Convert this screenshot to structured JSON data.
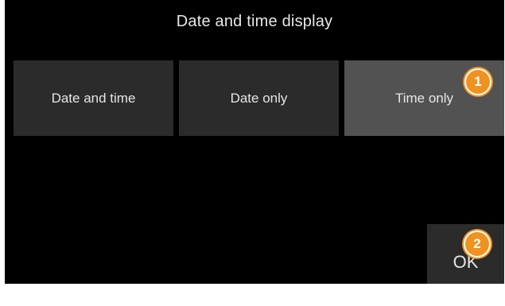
{
  "screen": {
    "title": "Date and time display"
  },
  "options": [
    {
      "label": "Date and time",
      "selected": false
    },
    {
      "label": "Date only",
      "selected": false
    },
    {
      "label": "Time only",
      "selected": true
    }
  ],
  "confirm": {
    "label": "OK"
  },
  "callouts": [
    {
      "number": "1"
    },
    {
      "number": "2"
    }
  ],
  "colors": {
    "background": "#000000",
    "button": "#2b2b2b",
    "button_selected": "#525252",
    "text": "#e6e6e6",
    "callout": "#f0921f"
  }
}
